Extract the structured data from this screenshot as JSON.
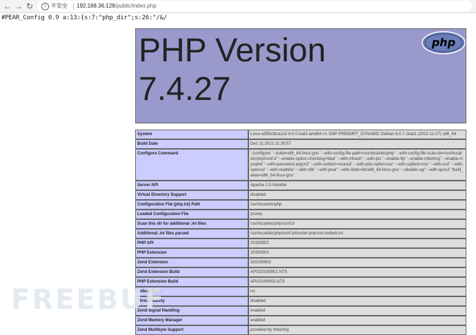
{
  "browser": {
    "security_label": "不安全",
    "url_host": "192.168.36.128",
    "url_path": "/public/index.php"
  },
  "page": {
    "pear_config": "#PEAR_Config 0.9 a:13:{s:7:\"php_dir\";s:26:\"/&/",
    "php_version_title": "PHP Version\n7.4.27",
    "logo_text": "php"
  },
  "info_rows": [
    {
      "key": "System",
      "value": "Linux e595cfdca1c5 6.0.0-kali3-amd64 #1 SMP PREEMPT_DYNAMIC Debian 6.0.7-1kali1 (2022-11-07) x86_64"
    },
    {
      "key": "Build Date",
      "value": "Dec 21 2021 21:30:57"
    },
    {
      "key": "Configure Command",
      "value": "'./configure' '--build=x86_64-linux-gnu' '--with-config-file-path=/usr/local/etc/php' '--with-config-file-scan-dir=/usr/local/etc/php/conf.d' '--enable-option-checking=fatal' '--with-mhash' '--with-pic' '--enable-ftp' '--enable-mbstring' '--enable-mysqlnd' '--with-password-argon2' '--with-sodium=shared' '--with-pdo-sqlite=/usr' '--with-sqlite3=/usr' '--with-curl' '--with-openssl' '--with-readline' '--with-zlib' '--with-pear' '--with-libdir=lib/x86_64-linux-gnu' '--disable-cgi' '--with-apxs2' 'build_alias=x86_64-linux-gnu'"
    },
    {
      "key": "Server API",
      "value": "Apache 2.0 Handler"
    },
    {
      "key": "Virtual Directory Support",
      "value": "disabled"
    },
    {
      "key": "Configuration File (php.ini) Path",
      "value": "/usr/local/etc/php"
    },
    {
      "key": "Loaded Configuration File",
      "value": "(none)"
    },
    {
      "key": "Scan this dir for additional .ini files",
      "value": "/usr/local/etc/php/conf.d"
    },
    {
      "key": "Additional .ini files parsed",
      "value": "/usr/local/etc/php/conf.d/docker-php-ext-sodium.ini"
    },
    {
      "key": "PHP API",
      "value": "20190902"
    },
    {
      "key": "PHP Extension",
      "value": "20190902"
    },
    {
      "key": "Zend Extension",
      "value": "320190902"
    },
    {
      "key": "Zend Extension Build",
      "value": "API320190902,NTS"
    },
    {
      "key": "PHP Extension Build",
      "value": "API20190902,NTS"
    },
    {
      "key": "Debug Build",
      "value": "no"
    },
    {
      "key": "Thread Safety",
      "value": "disabled"
    },
    {
      "key": "Zend Signal Handling",
      "value": "enabled"
    },
    {
      "key": "Zend Memory Manager",
      "value": "enabled"
    },
    {
      "key": "Zend Multibyte Support",
      "value": "provided by mbstring"
    }
  ],
  "watermark": "FREEBUF"
}
